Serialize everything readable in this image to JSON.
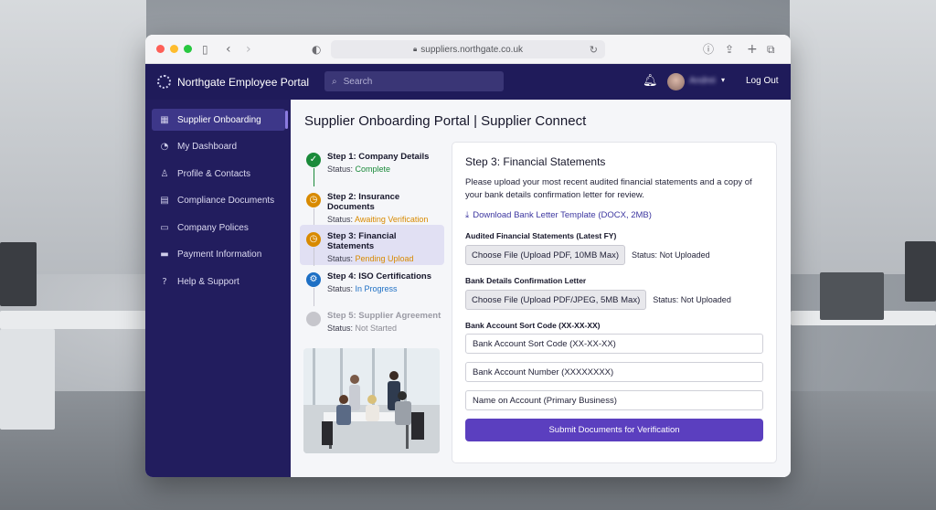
{
  "browser": {
    "url": "suppliers.northgate.co.uk",
    "icons": [
      "sidebar-icon",
      "back-icon",
      "forward-icon",
      "shield-icon",
      "lock-icon",
      "reload-icon",
      "info-icon",
      "share-icon",
      "new-tab-icon",
      "tabs-icon"
    ]
  },
  "header": {
    "brand": "Northgate Employee Portal",
    "search_placeholder": "Search",
    "user_name": "Andrei",
    "logout": "Log Out"
  },
  "sidebar": {
    "items": [
      {
        "label": "Supplier Onboarding",
        "icon": "grid-icon",
        "active": true
      },
      {
        "label": "My Dashboard",
        "icon": "gauge-icon",
        "active": false
      },
      {
        "label": "Profile & Contacts",
        "icon": "user-icon",
        "active": false
      },
      {
        "label": "Compliance Documents",
        "icon": "document-icon",
        "active": false
      },
      {
        "label": "Company Polices",
        "icon": "folder-icon",
        "active": false
      },
      {
        "label": "Payment Information",
        "icon": "card-icon",
        "active": false
      },
      {
        "label": "Help & Support",
        "icon": "help-icon",
        "active": false
      }
    ]
  },
  "page": {
    "title": "Supplier Onboarding Portal | Supplier Connect"
  },
  "steps": [
    {
      "title": "Step 1: Company Details",
      "status_label": "Status: ",
      "status": "Complete",
      "color": "#1a8a3a",
      "state": "complete"
    },
    {
      "title": "Step 2: Insurance Documents",
      "status_label": "Status: ",
      "status": "Awaiting Verification",
      "color": "#d88a00",
      "state": "pending"
    },
    {
      "title": "Step 3: Financial Statements",
      "status_label": "Status: ",
      "status": "Pending Upload",
      "color": "#d88a00",
      "state": "current"
    },
    {
      "title": "Step 4: ISO Certifications",
      "status_label": "Status: ",
      "status": "In Progress",
      "color": "#1d6fc4",
      "state": "progress"
    },
    {
      "title": "Step 5: Supplier Agreement",
      "status_label": "Status: ",
      "status": "Not Started",
      "color": "#8a8a93",
      "state": "inactive"
    }
  ],
  "form": {
    "title": "Step 3: Financial Statements",
    "description": "Please upload your most recent audited financial statements and a copy of your bank details confirmation letter for review.",
    "download_link": "Download Bank Letter Template (DOCX, 2MB)",
    "fields": [
      {
        "label": "Audited Financial Statements (Latest FY)",
        "button": "Choose File (Upload PDF, 10MB Max)",
        "status": "Status: Not Uploaded"
      },
      {
        "label": "Bank Details Confirmation Letter",
        "button": "Choose File (Upload PDF/JPEG, 5MB Max)",
        "status": "Status: Not Uploaded"
      }
    ],
    "inputs_label": "Bank Account Sort Code (XX-XX-XX)",
    "inputs": [
      {
        "placeholder": "Bank Account Sort Code (XX-XX-XX)"
      },
      {
        "placeholder": "Bank Account Number (XXXXXXXX)"
      },
      {
        "placeholder": "Name on Account (Primary Business)"
      }
    ],
    "submit": "Submit Documents for Verification"
  },
  "colors": {
    "nav": "#1f1b5a",
    "sidebar": "#221d5e",
    "accent": "#5b3fbf",
    "complete": "#1a8a3a",
    "pending": "#d88a00",
    "progress": "#1d6fc4"
  }
}
